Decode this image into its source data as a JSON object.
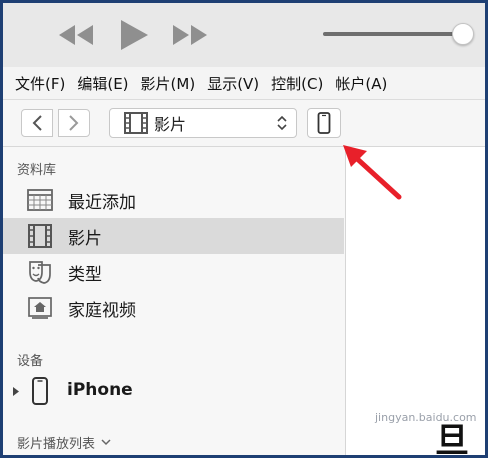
{
  "menubar": {
    "items": [
      "文件(F)",
      "编辑(E)",
      "影片(M)",
      "显示(V)",
      "控制(C)",
      "帐户(A)"
    ]
  },
  "toolbar": {
    "media_selected": "影片",
    "media_icon": "film-icon",
    "device_icon": "iphone-icon"
  },
  "sidebar": {
    "library_title": "资料库",
    "library_items": [
      {
        "label": "最近添加",
        "icon": "grid-icon",
        "selected": false
      },
      {
        "label": "影片",
        "icon": "film-icon",
        "selected": true
      },
      {
        "label": "类型",
        "icon": "masks-icon",
        "selected": false
      },
      {
        "label": "家庭视频",
        "icon": "home-video-icon",
        "selected": false
      }
    ],
    "devices_title": "设备",
    "device": {
      "label": "iPhone",
      "icon": "iphone-icon"
    },
    "playlists_title": "影片播放列表"
  },
  "watermark": {
    "text": "jingyan.baidu.com",
    "partial_char": "旦"
  },
  "colors": {
    "frame_border": "#1e3f73",
    "arrow": "#e8202a",
    "selected_row": "#dadada"
  },
  "volume": {
    "level": 1.0
  }
}
